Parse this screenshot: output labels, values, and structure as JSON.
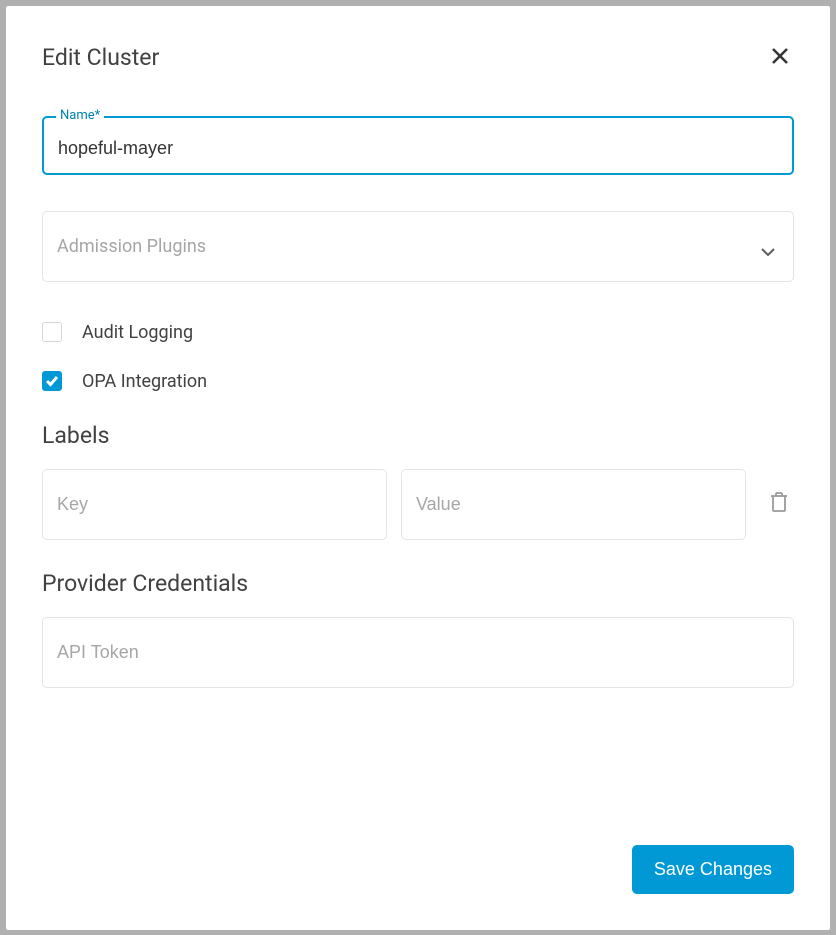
{
  "modal": {
    "title": "Edit Cluster",
    "name_field": {
      "label": "Name*",
      "value": "hopeful-mayer"
    },
    "admission_plugins": {
      "placeholder": "Admission Plugins"
    },
    "audit_logging": {
      "label": "Audit Logging",
      "checked": false
    },
    "opa_integration": {
      "label": "OPA Integration",
      "checked": true
    },
    "labels": {
      "title": "Labels",
      "key_placeholder": "Key",
      "value_placeholder": "Value"
    },
    "provider_credentials": {
      "title": "Provider Credentials",
      "api_token_placeholder": "API Token"
    },
    "save_button": "Save Changes"
  }
}
